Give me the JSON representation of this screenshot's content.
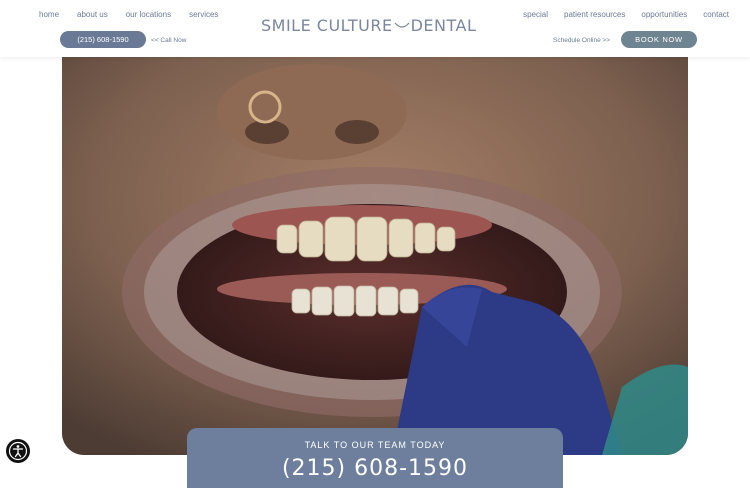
{
  "nav_left": [
    "home",
    "about us",
    "our locations",
    "services"
  ],
  "nav_right": [
    "special",
    "patient resources",
    "opportunities",
    "contact"
  ],
  "logo": {
    "left": "SMILE CULTURE",
    "right": "DENTAL"
  },
  "phone_button": "(215) 608-1590",
  "call_now": "<< Call Now",
  "schedule": "Schedule Online >>",
  "book_button": "BOOK NOW",
  "cta": {
    "label": "TALK TO OUR TEAM TODAY",
    "phone": "(215) 608-1590"
  },
  "accessibility": {
    "icon": "accessibility-icon"
  },
  "colors": {
    "brand": "#6a7a96",
    "book": "#6f8491",
    "cta": "#6d7f9c",
    "text": "#6b7a96"
  }
}
